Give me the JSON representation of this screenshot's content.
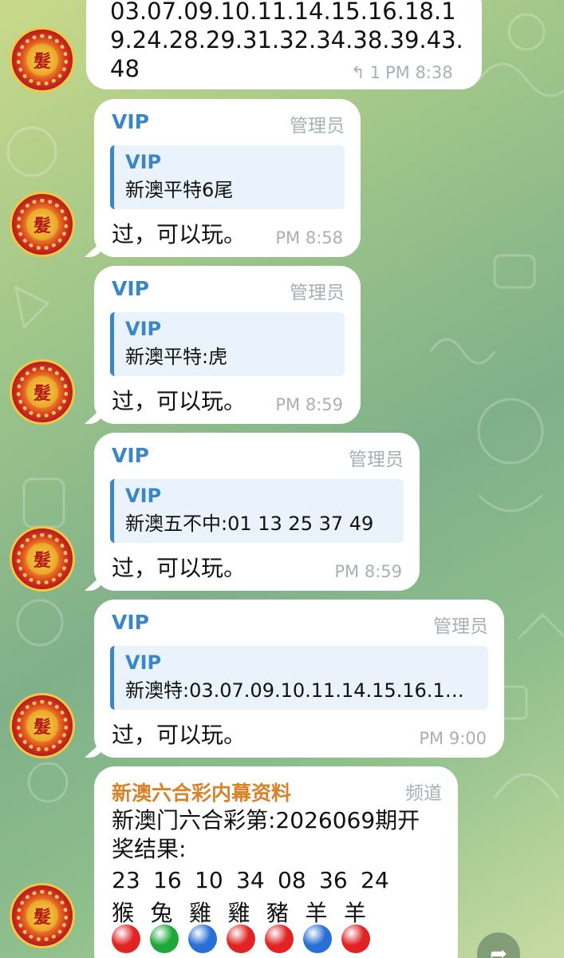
{
  "top_message": {
    "text": "03.07.09.10.11.14.15.16.18.19.24.28.29.31.32.34.38.39.43.48",
    "replies": "1",
    "time": "PM 8:38"
  },
  "messages": [
    {
      "sender": "VIP",
      "role": "管理员",
      "quote_sender": "VIP",
      "quote_text": "新澳平特6尾",
      "text": "过，可以玩。",
      "time": "PM 8:58"
    },
    {
      "sender": "VIP",
      "role": "管理员",
      "quote_sender": "VIP",
      "quote_text": "新澳平特:虎",
      "text": "过，可以玩。",
      "time": "PM 8:59"
    },
    {
      "sender": "VIP",
      "role": "管理员",
      "quote_sender": "VIP",
      "quote_text": "新澳五不中:01 13 25 37 49",
      "text": "过，可以玩。",
      "time": "PM 8:59"
    },
    {
      "sender": "VIP",
      "role": "管理员",
      "quote_sender": "VIP",
      "quote_text": "新澳特:03.07.09.10.11.14.15.16.1…",
      "text": "过，可以玩。",
      "time": "PM 9:00"
    }
  ],
  "channel_message": {
    "sender": "新澳六合彩内幕资料",
    "role": "频道",
    "line1": "新澳门六合彩第:2026069期开",
    "line2": "奖结果:",
    "numbers": [
      "23",
      "16",
      "10",
      "34",
      "08",
      "36",
      "24"
    ],
    "zodiacs": [
      "猴",
      "兔",
      "雞",
      "雞",
      "豬",
      "羊",
      "羊"
    ],
    "ball_colors": [
      "#e02424",
      "#1fa83a",
      "#2a6fd6",
      "#e02424",
      "#e02424",
      "#2a6fd6",
      "#e02424"
    ]
  },
  "avatar": {
    "label": "髮",
    "icon": "lion-dance-avatar-icon"
  },
  "icons": {
    "reply": "reply-arrow-icon",
    "share": "share-arrow-icon"
  }
}
